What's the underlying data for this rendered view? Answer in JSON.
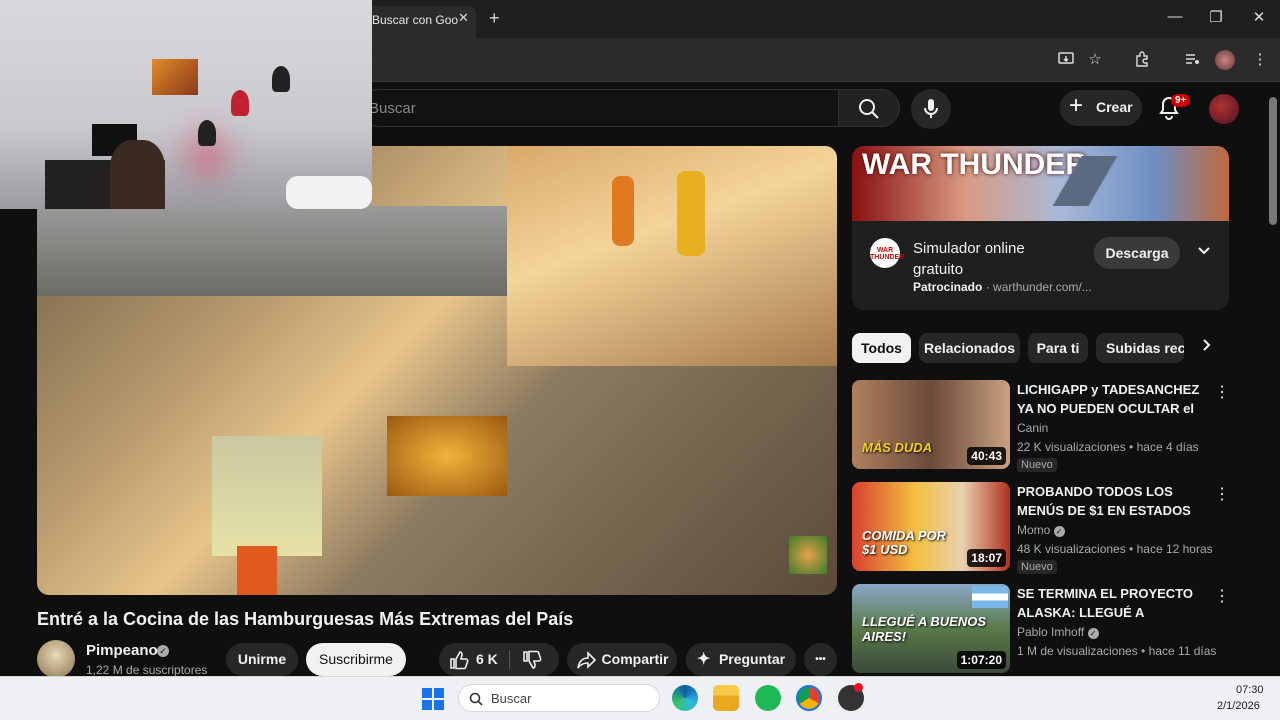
{
  "browser": {
    "tab_title": "Buscar con Goo",
    "tab_close": "✕",
    "new_tab": "+",
    "window_controls": {
      "minimize": "—",
      "maximize": "❐",
      "close": "✕"
    }
  },
  "youtube": {
    "search_placeholder": "Buscar",
    "create_label": "Crear",
    "notifications_badge": "9+"
  },
  "video": {
    "title": "Entré a la Cocina de las Hamburguesas Más Extremas del País",
    "channel_name": "Pimpeano",
    "subscribers": "1,22 M de suscriptores",
    "join_label": "Unirme",
    "subscribe_label": "Suscribirme",
    "likes": "6 K",
    "share_label": "Compartir",
    "ask_label": "Preguntar",
    "more_label": "•••"
  },
  "ad": {
    "banner_text": "WAR THUNDER",
    "icon_text": "WAR THUNDER",
    "title": "Simulador online gratuito",
    "sponsored_label": "Patrocinado",
    "domain": "warthunder.com/...",
    "cta_label": "Descarga"
  },
  "chips": [
    "Todos",
    "Relacionados",
    "Para ti",
    "Subidas recie"
  ],
  "recommendations": [
    {
      "title": "LICHIGAPP y TADESANCHEZ YA NO PUEDEN OCULTAR el ...",
      "channel": "Canin",
      "verified": false,
      "meta": "22 K visualizaciones • hace 4 días",
      "badge": "Nuevo",
      "duration": "40:43",
      "thumb_caption": "MÁS DUDA",
      "thumb_color": "#5a3a2a"
    },
    {
      "title": "PROBANDO TODOS LOS MENÚS DE $1 EN ESTADOS ...",
      "channel": "Momo",
      "verified": true,
      "meta": "48 K visualizaciones • hace 12 horas",
      "badge": "Nuevo",
      "duration": "18:07",
      "thumb_caption": "COMIDA POR $1 USD",
      "thumb_color": "#c0392b"
    },
    {
      "title": "SE TERMINA EL PROYECTO ALASKA: LLEGUÉ A BUENOS ...",
      "channel": "Pablo Imhoff",
      "verified": true,
      "meta": "1 M de visualizaciones • hace 11 días",
      "badge": "",
      "duration": "1:07:20",
      "thumb_caption": "LLEGUÉ A BUENOS AIRES!",
      "thumb_color": "#4a6a3a"
    }
  ],
  "taskbar": {
    "search_placeholder": "Buscar",
    "time": "07:30",
    "date": "2/1/2026"
  },
  "colors": {
    "background": "#0f0f0f",
    "chip_active": "#f1f1f1",
    "notification_red": "#cc0000",
    "taskbar": "#eef0f4"
  }
}
